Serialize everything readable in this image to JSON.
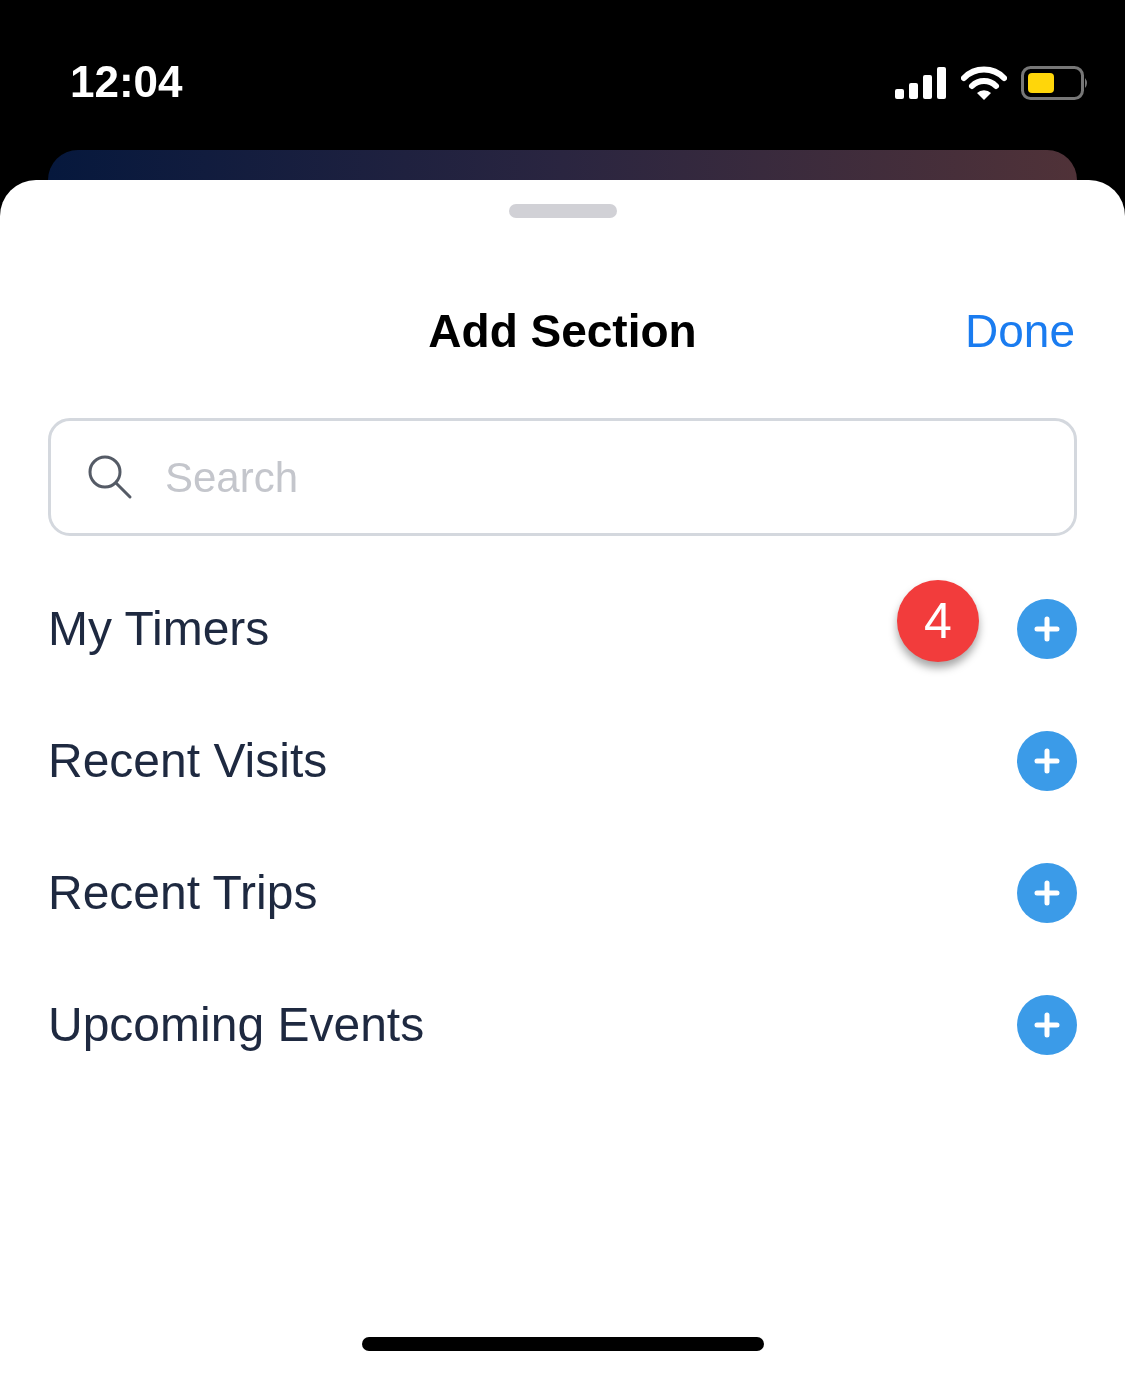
{
  "status_bar": {
    "time": "12:04"
  },
  "sheet": {
    "title": "Add Section",
    "done_label": "Done"
  },
  "search": {
    "placeholder": "Search"
  },
  "sections": [
    {
      "label": "My Timers",
      "badge": "4"
    },
    {
      "label": "Recent Visits"
    },
    {
      "label": "Recent Trips"
    },
    {
      "label": "Upcoming Events"
    }
  ]
}
